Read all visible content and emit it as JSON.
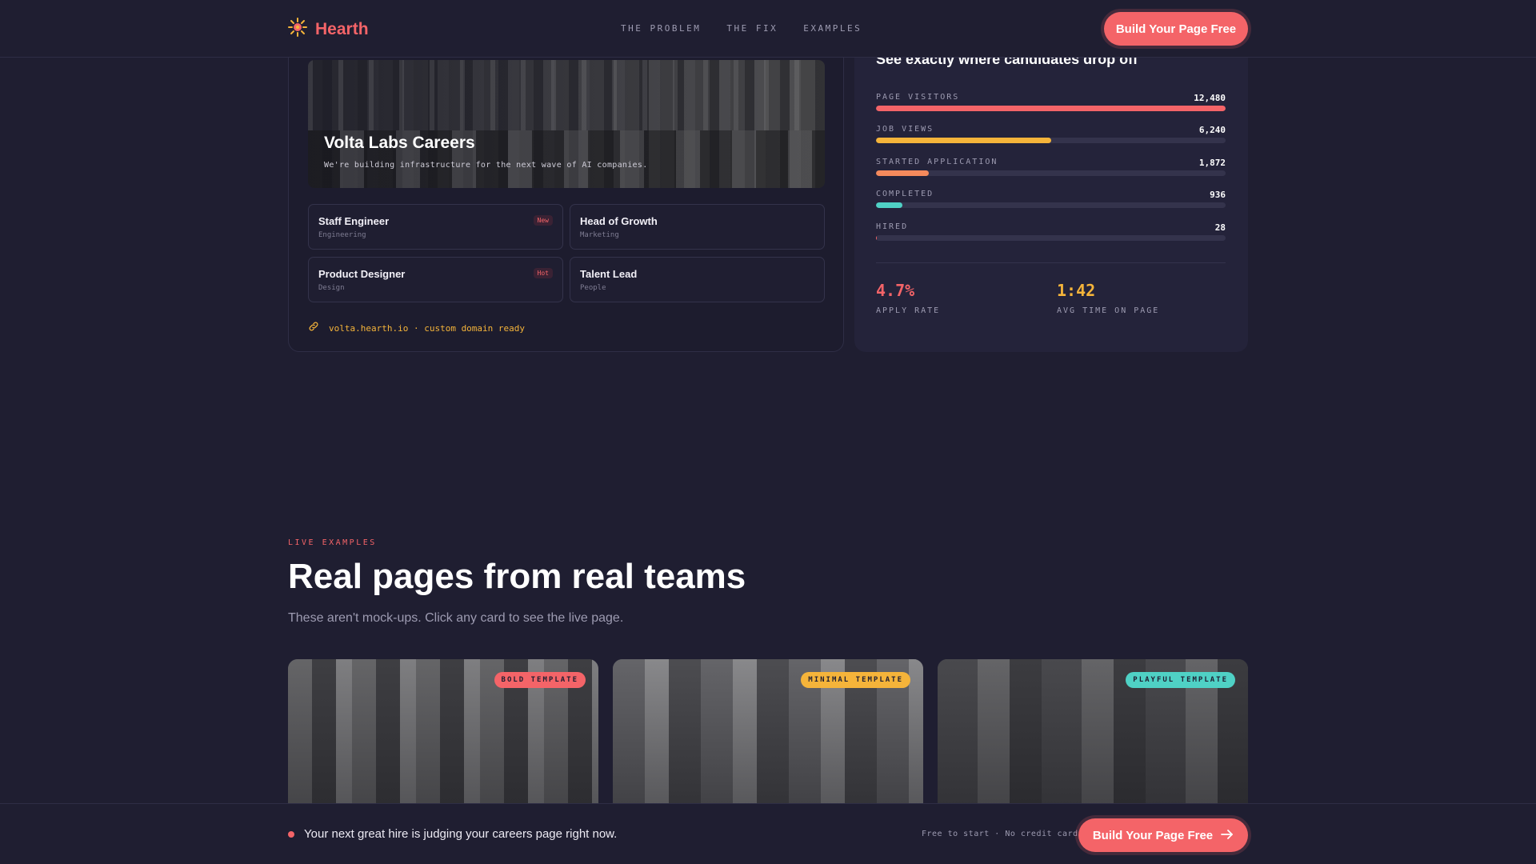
{
  "nav": {
    "brand": "Hearth",
    "links": [
      "THE PROBLEM",
      "THE FIX",
      "EXAMPLES"
    ],
    "cta": "Build Your Page Free"
  },
  "careers": {
    "title": "Volta Labs Careers",
    "subtitle": "We're building infrastructure for the next wave of AI companies.",
    "jobs": [
      {
        "title": "Staff Engineer",
        "dept": "Engineering",
        "badge": "New"
      },
      {
        "title": "Head of Growth",
        "dept": "Marketing",
        "badge": ""
      },
      {
        "title": "Product Designer",
        "dept": "Design",
        "badge": "Hot"
      },
      {
        "title": "Talent Lead",
        "dept": "People",
        "badge": ""
      }
    ],
    "domain": "volta.hearth.io · custom domain ready"
  },
  "funnel": {
    "title": "See exactly where candidates drop off",
    "rows": [
      {
        "label": "PAGE VISITORS",
        "value": "12,480",
        "fraction": 1.0,
        "color": "#f46468"
      },
      {
        "label": "JOB VIEWS",
        "value": "6,240",
        "fraction": 0.5,
        "color": "#f5b43a"
      },
      {
        "label": "STARTED APPLICATION",
        "value": "1,872",
        "fraction": 0.15,
        "color": "#f58a5c"
      },
      {
        "label": "COMPLETED",
        "value": "936",
        "fraction": 0.075,
        "color": "#4fd1c5"
      },
      {
        "label": "HIRED",
        "value": "28",
        "fraction": 0.0022,
        "color": "#f46468"
      }
    ],
    "metrics": [
      {
        "value": "4.7%",
        "label": "APPLY RATE",
        "color": "#f46468"
      },
      {
        "value": "1:42",
        "label": "AVG TIME ON PAGE",
        "color": "#f5b43a"
      }
    ]
  },
  "examples": {
    "eyebrow": "LIVE EXAMPLES",
    "title": "Real pages from real teams",
    "subtitle": "These aren't mock-ups. Click any card to see the live page.",
    "cards": [
      {
        "badge": "BOLD TEMPLATE",
        "badge_bg": "#f46468",
        "badge_fg": "#1f1e31"
      },
      {
        "badge": "MINIMAL TEMPLATE",
        "badge_bg": "#f5b43a",
        "badge_fg": "#1f1e31"
      },
      {
        "badge": "PLAYFUL TEMPLATE",
        "badge_bg": "#4fd1c5",
        "badge_fg": "#1f1e31"
      }
    ]
  },
  "sticky": {
    "text": "Your next great hire is judging your careers page right now.",
    "note": "Free to start · No credit card",
    "cta": "Build Your Page Free"
  },
  "icons": {
    "logo": "sun-icon",
    "domain": "link-icon",
    "cta_arrow": "arrow-right-icon"
  }
}
